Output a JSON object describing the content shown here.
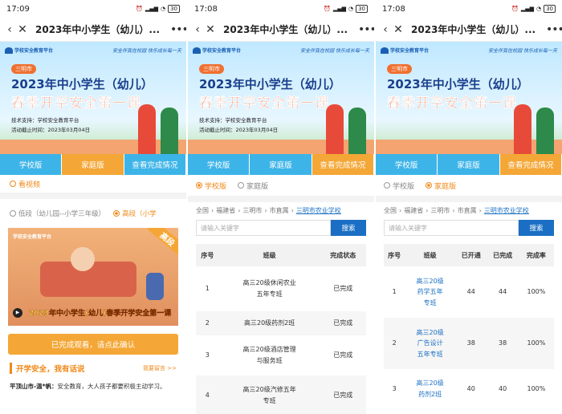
{
  "panel1": {
    "status_time": "17:09",
    "battery": "30",
    "nav_title": "2023年中小学生（幼儿）...",
    "banner": {
      "platform": "学校安全教育平台",
      "slogan": "安全伴我在校园 快乐成长每一天",
      "city": "三明市",
      "title1": "2023年中小学生（幼儿）",
      "title2": "春季开学安全第一课",
      "support": "技术支持：学校安全教育平台",
      "deadline": "活动截止时间：2023年03月04日"
    },
    "tabs": [
      "学校版",
      "家庭版",
      "查看完成情况"
    ],
    "watched_label": "看视频",
    "radio_low": "低段（幼儿园--小学三年级）",
    "radio_high": "高段（小学",
    "thumb": {
      "logo": "学校安全教育平台",
      "tag": "高段",
      "caption": "2023年中小学生(幼儿)春季开学安全第一课"
    },
    "confirm_button": "已完成观看，请点此确认",
    "talk_heading": "开学安全，我有话说",
    "talk_link": "我要留言 >>",
    "comment_author": "平顶山市-温*帆：",
    "comment_text": "安全教育，大人孩子都要积极主动学习。"
  },
  "panel2": {
    "status_time": "17:08",
    "battery": "30",
    "nav_title": "2023年中小学生（幼儿）...",
    "tabs": [
      "学校版",
      "家庭版",
      "查看完成情况"
    ],
    "radio_school": "学校版",
    "radio_family": "家庭版",
    "breadcrumb": [
      "全国",
      "福建省",
      "三明市",
      "市直属",
      "三明市农业学校"
    ],
    "search_placeholder": "请输入关键字",
    "search_button": "搜索",
    "headers": [
      "序号",
      "班级",
      "完成状态"
    ],
    "rows": [
      {
        "no": "1",
        "cls1": "高三20级休闲农业",
        "cls2": "五年专班",
        "status": "已完成"
      },
      {
        "no": "2",
        "cls1": "高三20级药剂2班",
        "cls2": "",
        "status": "已完成"
      },
      {
        "no": "3",
        "cls1": "高三20级酒店管理",
        "cls2": "与服务班",
        "status": "已完成"
      },
      {
        "no": "4",
        "cls1": "高三20级汽修五年",
        "cls2": "专班",
        "status": "已完成"
      }
    ]
  },
  "panel3": {
    "status_time": "17:08",
    "battery": "30",
    "nav_title": "2023年中小学生（幼儿）...",
    "tabs": [
      "学校版",
      "家庭版",
      "查看完成情况"
    ],
    "radio_school": "学校版",
    "radio_family": "家庭版",
    "breadcrumb": [
      "全国",
      "福建省",
      "三明市",
      "市直属",
      "三明市农业学校"
    ],
    "search_placeholder": "请输入关键字",
    "search_button": "搜索",
    "headers": [
      "序号",
      "班级",
      "已开通",
      "已完成",
      "完成率"
    ],
    "rows": [
      {
        "no": "1",
        "c1": "高三20级",
        "c2": "药学五年",
        "c3": "专班",
        "open": "44",
        "done": "44",
        "rate": "100%"
      },
      {
        "no": "2",
        "c1": "高三20级",
        "c2": "广告设计",
        "c3": "五年专班",
        "open": "38",
        "done": "38",
        "rate": "100%"
      },
      {
        "no": "3",
        "c1": "高三20级",
        "c2": "药剂2班",
        "c3": "",
        "open": "40",
        "done": "40",
        "rate": "100%"
      }
    ]
  }
}
